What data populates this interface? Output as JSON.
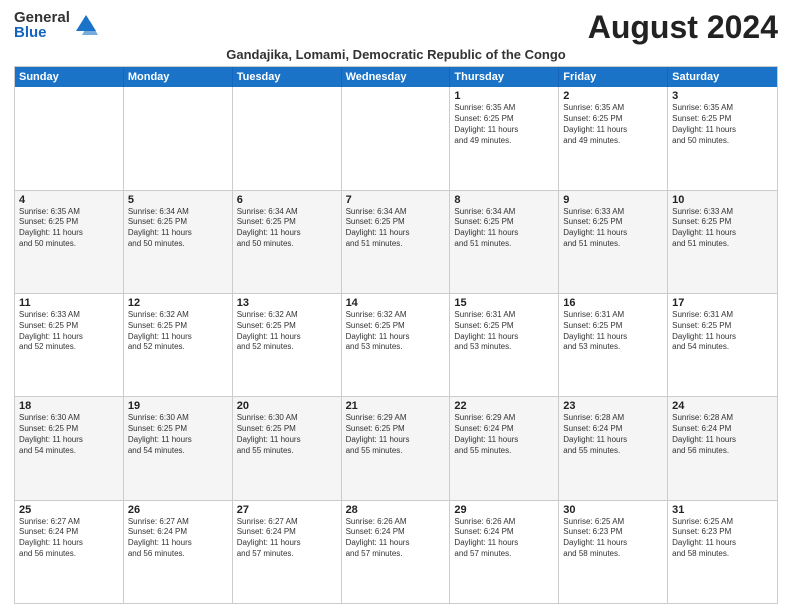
{
  "logo": {
    "general": "General",
    "blue": "Blue"
  },
  "title": "August 2024",
  "subtitle": "Gandajika, Lomami, Democratic Republic of the Congo",
  "header_days": [
    "Sunday",
    "Monday",
    "Tuesday",
    "Wednesday",
    "Thursday",
    "Friday",
    "Saturday"
  ],
  "weeks": [
    [
      {
        "day": "",
        "text": ""
      },
      {
        "day": "",
        "text": ""
      },
      {
        "day": "",
        "text": ""
      },
      {
        "day": "",
        "text": ""
      },
      {
        "day": "1",
        "text": "Sunrise: 6:35 AM\nSunset: 6:25 PM\nDaylight: 11 hours\nand 49 minutes."
      },
      {
        "day": "2",
        "text": "Sunrise: 6:35 AM\nSunset: 6:25 PM\nDaylight: 11 hours\nand 49 minutes."
      },
      {
        "day": "3",
        "text": "Sunrise: 6:35 AM\nSunset: 6:25 PM\nDaylight: 11 hours\nand 50 minutes."
      }
    ],
    [
      {
        "day": "4",
        "text": "Sunrise: 6:35 AM\nSunset: 6:25 PM\nDaylight: 11 hours\nand 50 minutes."
      },
      {
        "day": "5",
        "text": "Sunrise: 6:34 AM\nSunset: 6:25 PM\nDaylight: 11 hours\nand 50 minutes."
      },
      {
        "day": "6",
        "text": "Sunrise: 6:34 AM\nSunset: 6:25 PM\nDaylight: 11 hours\nand 50 minutes."
      },
      {
        "day": "7",
        "text": "Sunrise: 6:34 AM\nSunset: 6:25 PM\nDaylight: 11 hours\nand 51 minutes."
      },
      {
        "day": "8",
        "text": "Sunrise: 6:34 AM\nSunset: 6:25 PM\nDaylight: 11 hours\nand 51 minutes."
      },
      {
        "day": "9",
        "text": "Sunrise: 6:33 AM\nSunset: 6:25 PM\nDaylight: 11 hours\nand 51 minutes."
      },
      {
        "day": "10",
        "text": "Sunrise: 6:33 AM\nSunset: 6:25 PM\nDaylight: 11 hours\nand 51 minutes."
      }
    ],
    [
      {
        "day": "11",
        "text": "Sunrise: 6:33 AM\nSunset: 6:25 PM\nDaylight: 11 hours\nand 52 minutes."
      },
      {
        "day": "12",
        "text": "Sunrise: 6:32 AM\nSunset: 6:25 PM\nDaylight: 11 hours\nand 52 minutes."
      },
      {
        "day": "13",
        "text": "Sunrise: 6:32 AM\nSunset: 6:25 PM\nDaylight: 11 hours\nand 52 minutes."
      },
      {
        "day": "14",
        "text": "Sunrise: 6:32 AM\nSunset: 6:25 PM\nDaylight: 11 hours\nand 53 minutes."
      },
      {
        "day": "15",
        "text": "Sunrise: 6:31 AM\nSunset: 6:25 PM\nDaylight: 11 hours\nand 53 minutes."
      },
      {
        "day": "16",
        "text": "Sunrise: 6:31 AM\nSunset: 6:25 PM\nDaylight: 11 hours\nand 53 minutes."
      },
      {
        "day": "17",
        "text": "Sunrise: 6:31 AM\nSunset: 6:25 PM\nDaylight: 11 hours\nand 54 minutes."
      }
    ],
    [
      {
        "day": "18",
        "text": "Sunrise: 6:30 AM\nSunset: 6:25 PM\nDaylight: 11 hours\nand 54 minutes."
      },
      {
        "day": "19",
        "text": "Sunrise: 6:30 AM\nSunset: 6:25 PM\nDaylight: 11 hours\nand 54 minutes."
      },
      {
        "day": "20",
        "text": "Sunrise: 6:30 AM\nSunset: 6:25 PM\nDaylight: 11 hours\nand 55 minutes."
      },
      {
        "day": "21",
        "text": "Sunrise: 6:29 AM\nSunset: 6:25 PM\nDaylight: 11 hours\nand 55 minutes."
      },
      {
        "day": "22",
        "text": "Sunrise: 6:29 AM\nSunset: 6:24 PM\nDaylight: 11 hours\nand 55 minutes."
      },
      {
        "day": "23",
        "text": "Sunrise: 6:28 AM\nSunset: 6:24 PM\nDaylight: 11 hours\nand 55 minutes."
      },
      {
        "day": "24",
        "text": "Sunrise: 6:28 AM\nSunset: 6:24 PM\nDaylight: 11 hours\nand 56 minutes."
      }
    ],
    [
      {
        "day": "25",
        "text": "Sunrise: 6:27 AM\nSunset: 6:24 PM\nDaylight: 11 hours\nand 56 minutes."
      },
      {
        "day": "26",
        "text": "Sunrise: 6:27 AM\nSunset: 6:24 PM\nDaylight: 11 hours\nand 56 minutes."
      },
      {
        "day": "27",
        "text": "Sunrise: 6:27 AM\nSunset: 6:24 PM\nDaylight: 11 hours\nand 57 minutes."
      },
      {
        "day": "28",
        "text": "Sunrise: 6:26 AM\nSunset: 6:24 PM\nDaylight: 11 hours\nand 57 minutes."
      },
      {
        "day": "29",
        "text": "Sunrise: 6:26 AM\nSunset: 6:24 PM\nDaylight: 11 hours\nand 57 minutes."
      },
      {
        "day": "30",
        "text": "Sunrise: 6:25 AM\nSunset: 6:23 PM\nDaylight: 11 hours\nand 58 minutes."
      },
      {
        "day": "31",
        "text": "Sunrise: 6:25 AM\nSunset: 6:23 PM\nDaylight: 11 hours\nand 58 minutes."
      }
    ]
  ]
}
